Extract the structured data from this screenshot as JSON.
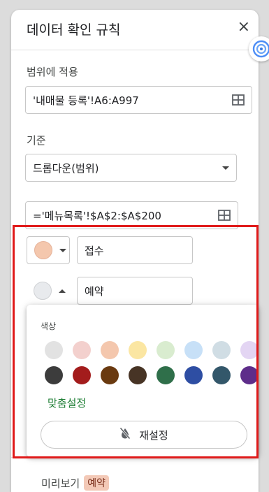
{
  "dialog": {
    "title": "데이터 확인 규칙",
    "close": "×"
  },
  "range": {
    "label": "범위에 적용",
    "value": "'내매물 등록'!A6:A997"
  },
  "criteria": {
    "label": "기준",
    "type": "드롭다운(범위)",
    "source": "='메뉴목록'!$A$2:$A$200"
  },
  "items": [
    {
      "color": "#f4c7ad",
      "text": "접수"
    },
    {
      "color": "#e8eaed",
      "text": "예약"
    }
  ],
  "palette": {
    "label": "색상",
    "row1": [
      "#e2e2e2",
      "#f3d0cd",
      "#f4c7ad",
      "#fbe6a2",
      "#d9eccf",
      "#c7e0f7",
      "#d0dde4",
      "#e3d5f3"
    ],
    "row2": [
      "#3c3c3c",
      "#a31c1c",
      "#6a3a10",
      "#473425",
      "#2f6f4a",
      "#2e4ea3",
      "#33576a",
      "#5e2d8a"
    ],
    "custom": "맞춤설정",
    "reset": "재설정"
  },
  "preview": {
    "label": "미리보기",
    "chip": "예약"
  },
  "icons": {
    "close": "close-icon",
    "grid": "grid-icon",
    "reset": "format-color-reset-icon",
    "side": "gemini-swirl-icon"
  }
}
